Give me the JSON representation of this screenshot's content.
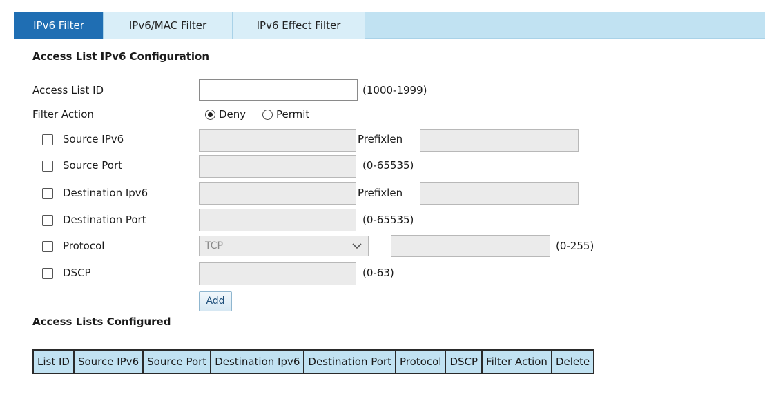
{
  "tabs": [
    {
      "label": "IPv6 Filter",
      "active": true
    },
    {
      "label": "IPv6/MAC Filter",
      "active": false
    },
    {
      "label": "IPv6 Effect Filter",
      "active": false
    }
  ],
  "config": {
    "title": "Access List IPv6 Configuration",
    "access_list_id": {
      "label": "Access List ID",
      "value": "",
      "hint": "(1000-1999)"
    },
    "filter_action": {
      "label": "Filter Action",
      "options": [
        "Deny",
        "Permit"
      ],
      "selected": "Deny"
    },
    "source_ipv6": {
      "label": "Source IPv6",
      "checked": false,
      "value": "",
      "prefix_label": "Prefixlen",
      "prefix_value": ""
    },
    "source_port": {
      "label": "Source Port",
      "checked": false,
      "value": "",
      "hint": "(0-65535)"
    },
    "destination_ipv6": {
      "label": "Destination Ipv6",
      "checked": false,
      "value": "",
      "prefix_label": "Prefixlen",
      "prefix_value": ""
    },
    "destination_port": {
      "label": "Destination Port",
      "checked": false,
      "value": "",
      "hint": "(0-65535)"
    },
    "protocol": {
      "label": "Protocol",
      "checked": false,
      "selected": "TCP",
      "value": "",
      "hint": "(0-255)"
    },
    "dscp": {
      "label": "DSCP",
      "checked": false,
      "value": "",
      "hint": "(0-63)"
    },
    "add_label": "Add"
  },
  "lists": {
    "title": "Access Lists Configured",
    "columns": [
      "List ID",
      "Source IPv6",
      "Source Port",
      "Destination Ipv6",
      "Destination Port",
      "Protocol",
      "DSCP",
      "Filter Action",
      "Delete"
    ]
  },
  "colors": {
    "tab_active": "#1f6eb3",
    "tab_bar": "#c1e2f2",
    "header_bg": "#c1e2f2"
  }
}
